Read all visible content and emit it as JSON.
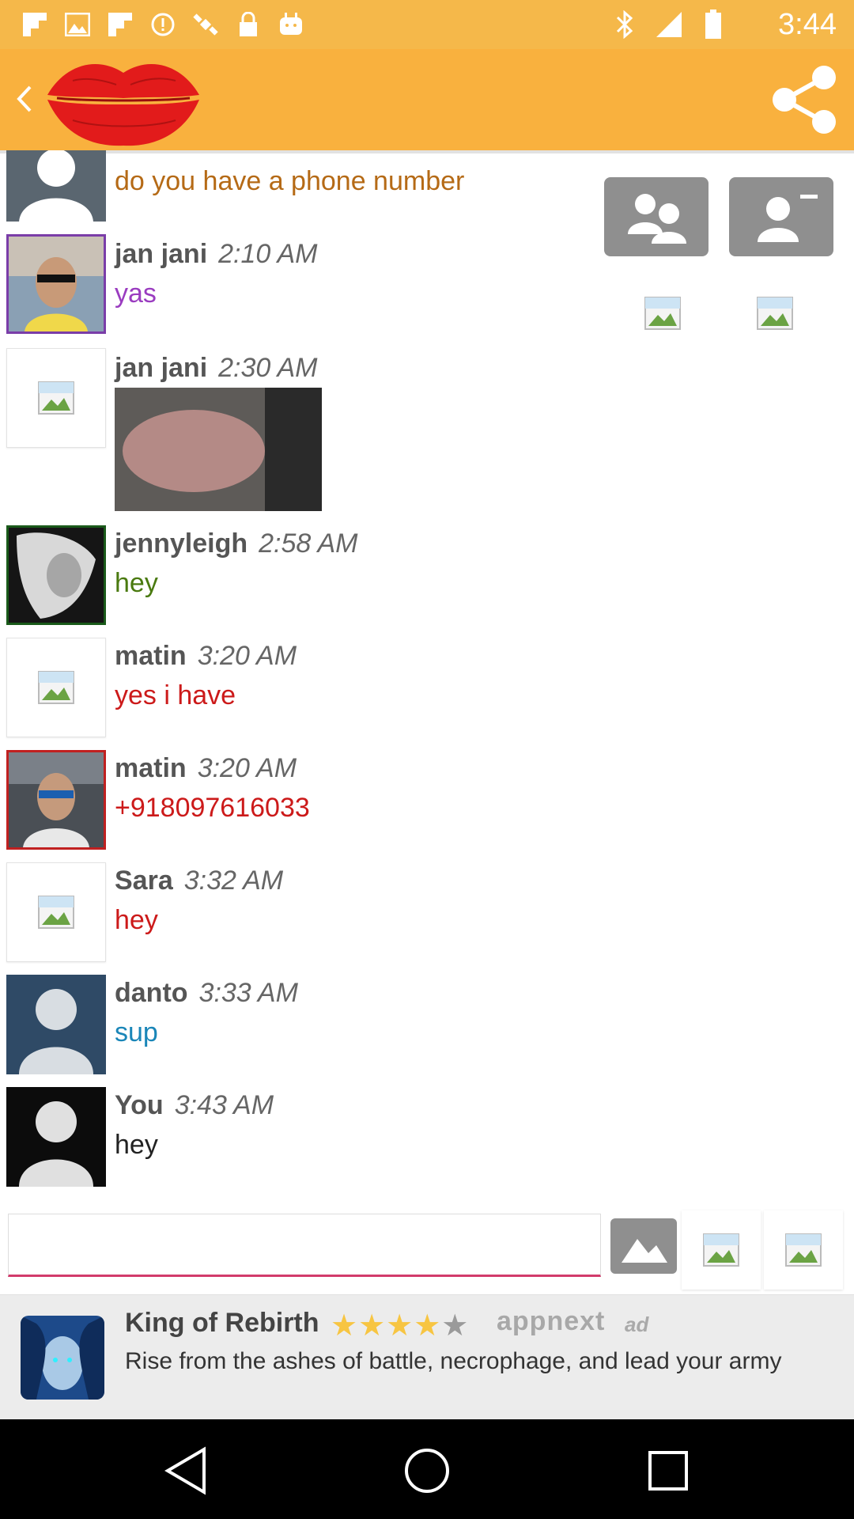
{
  "status_bar": {
    "time": "3:44",
    "icons": [
      "flipboard-icon",
      "image-icon",
      "flipboard-icon",
      "info-icon",
      "satellite-icon",
      "lock-icon",
      "android-icon",
      "bluetooth-icon",
      "signal-icon",
      "battery-icon"
    ]
  },
  "appbar": {
    "logo": "lips-logo",
    "share_icon": "share-icon",
    "back_icon": "back-arrow-icon"
  },
  "messages": [
    {
      "name": "",
      "time": "",
      "text": "do you have a phone number",
      "text_color": "#b56a16",
      "avatar": "default-gray"
    },
    {
      "name": "jan jani",
      "time": "2:10 AM",
      "text": "yas",
      "text_color": "#9a3cc0",
      "avatar": "photo-purple"
    },
    {
      "name": "jan jani",
      "time": "2:30 AM",
      "text": "",
      "text_color": "#333333",
      "avatar": "broken",
      "has_image": true
    },
    {
      "name": "jennyleigh",
      "time": "2:58 AM",
      "text": "hey",
      "text_color": "#4a7a10",
      "avatar": "photo-green"
    },
    {
      "name": "matin",
      "time": "3:20 AM",
      "text": "yes i have",
      "text_color": "#cc1a1a",
      "avatar": "broken"
    },
    {
      "name": "matin",
      "time": "3:20 AM",
      "text": "+918097616033",
      "text_color": "#cc1a1a",
      "avatar": "photo-red"
    },
    {
      "name": "Sara",
      "time": "3:32 AM",
      "text": "hey",
      "text_color": "#cc1a1a",
      "avatar": "broken"
    },
    {
      "name": "danto",
      "time": "3:33 AM",
      "text": "sup",
      "text_color": "#1a86b8",
      "avatar": "default-blue"
    },
    {
      "name": "You",
      "time": "3:43 AM",
      "text": "hey",
      "text_color": "#222222",
      "avatar": "default-dark"
    }
  ],
  "composer": {
    "placeholder": "",
    "value": ""
  },
  "ad": {
    "title": "King of Rebirth",
    "rating": 4,
    "rating_max": 5,
    "brand": "appnext",
    "tag": "ad",
    "description": "Rise from the ashes of battle, necrophage, and lead your army"
  },
  "colors": {
    "appbar": "#f9b13e",
    "statusbar": "#f5b84a",
    "input_underline": "#d23b6b"
  }
}
